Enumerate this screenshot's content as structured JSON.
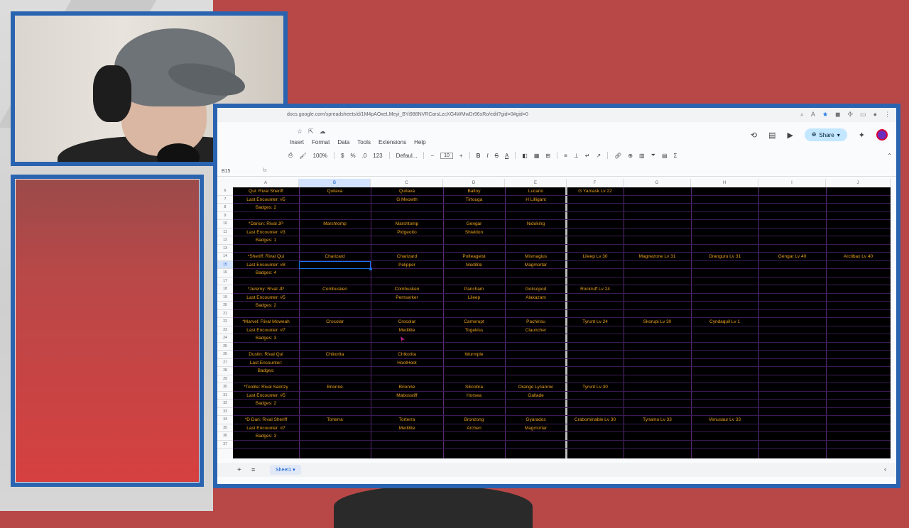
{
  "browser": {
    "url": "docs.google.com/spreadsheets/d/1M4pAOxeLMeyi_BYi988NVRCarsLzcXG4WMwDr96sRo/edit?gid=0#gid=0",
    "menu": [
      "Insert",
      "Format",
      "Data",
      "Tools",
      "Extensions",
      "Help"
    ],
    "share_label": "Share"
  },
  "toolbar": {
    "zoom": "100%",
    "currency": "$",
    "percent": "%",
    "decimals": ".0",
    "more_formats": "123",
    "font": "Defaul...",
    "font_size": "10",
    "bold": "B",
    "italic": "I",
    "strike": "S",
    "text_color": "A"
  },
  "formula_bar": {
    "name_box": "B15",
    "fx": "fx"
  },
  "columns": [
    "A",
    "B",
    "C",
    "D",
    "E",
    "F",
    "G",
    "H",
    "I",
    "J"
  ],
  "selected_column": "B",
  "rows": [
    {
      "num": "6",
      "cells": [
        "Qui: Rival Sheriff",
        "Quilava",
        "Quilava",
        "Baltoy",
        "Lucario",
        "G Yamask Lv 22",
        "",
        "",
        "",
        ""
      ]
    },
    {
      "num": "7",
      "cells": [
        "Last Encounter: #5",
        "",
        "G Meowth",
        "Tirtouga",
        "H Lilligant",
        "",
        "",
        "",
        "",
        ""
      ]
    },
    {
      "num": "8",
      "cells": [
        "Badges: 2",
        "",
        "",
        "",
        "",
        "",
        "",
        "",
        "",
        ""
      ]
    },
    {
      "num": "9",
      "cells": [
        "",
        "",
        "",
        "",
        "",
        "",
        "",
        "",
        "",
        ""
      ]
    },
    {
      "num": "10",
      "cells": [
        "*Darion: Rival JP",
        "Marshtomp",
        "Marshtomp",
        "Gengar",
        "Nidoking",
        "",
        "",
        "",
        "",
        ""
      ]
    },
    {
      "num": "11",
      "cells": [
        "Last Encounter: #3",
        "",
        "Pidgeotto",
        "Shieldon",
        "",
        "",
        "",
        "",
        "",
        ""
      ]
    },
    {
      "num": "12",
      "cells": [
        "Badges: 1",
        "",
        "",
        "",
        "",
        "",
        "",
        "",
        "",
        ""
      ]
    },
    {
      "num": "13",
      "cells": [
        "",
        "",
        "",
        "",
        "",
        "",
        "",
        "",
        "",
        ""
      ]
    },
    {
      "num": "14",
      "cells": [
        "*Sheriff: Rival Qui",
        "Charizard",
        "Charizard",
        "Polteageist",
        "Mismagius",
        "Lileep Lv 30",
        "Magnezone Lv 31",
        "Oranguru Lv 31",
        "Gengar Lv 40",
        "Arctibax Lv 40"
      ]
    },
    {
      "num": "15",
      "cells": [
        "Last Encounter: #8",
        "",
        "Pelipper",
        "Meditite",
        "Magmortar",
        "",
        "",
        "",
        "",
        ""
      ]
    },
    {
      "num": "16",
      "cells": [
        "Badges: 4",
        "",
        "",
        "",
        "",
        "",
        "",
        "",
        "",
        ""
      ]
    },
    {
      "num": "17",
      "cells": [
        "",
        "",
        "",
        "",
        "",
        "",
        "",
        "",
        "",
        ""
      ]
    },
    {
      "num": "18",
      "cells": [
        "*Jeremy: Rival JP",
        "Combusken",
        "Combusken",
        "Pancham",
        "Golisopod",
        "Rockruff Lv 24",
        "",
        "",
        "",
        ""
      ]
    },
    {
      "num": "19",
      "cells": [
        "Last Encounter: #5",
        "",
        "Pemserker",
        "Lileep",
        "Alakazam",
        "",
        "",
        "",
        "",
        ""
      ]
    },
    {
      "num": "20",
      "cells": [
        "Badges: 2",
        "",
        "",
        "",
        "",
        "",
        "",
        "",
        "",
        ""
      ]
    },
    {
      "num": "21",
      "cells": [
        "",
        "",
        "",
        "",
        "",
        "",
        "",
        "",
        "",
        ""
      ]
    },
    {
      "num": "22",
      "cells": [
        "*Marvel: Rival Moweah",
        "Crocolar",
        "Crocolar",
        "Camerupt",
        "Pachirisu",
        "Tyrunt Lv 24",
        "Skorupi Lv 30",
        "Cyndaquil Lv 1",
        "",
        ""
      ]
    },
    {
      "num": "23",
      "cells": [
        "Last Encounter: #7",
        "",
        "Meditite",
        "Togekiss",
        "Clauncher",
        "",
        "",
        "",
        "",
        ""
      ]
    },
    {
      "num": "24",
      "cells": [
        "Badges: 3",
        "",
        "",
        "",
        "",
        "",
        "",
        "",
        "",
        ""
      ]
    },
    {
      "num": "25",
      "cells": [
        "",
        "",
        "",
        "",
        "",
        "",
        "",
        "",
        "",
        ""
      ]
    },
    {
      "num": "26",
      "cells": [
        "Dustin: Rival Qui",
        "Chikorita",
        "Chikorita",
        "Wurmple",
        "",
        "",
        "",
        "",
        "",
        ""
      ]
    },
    {
      "num": "27",
      "cells": [
        "Last Encounter:",
        "",
        "HootHoot",
        "",
        "",
        "",
        "",
        "",
        "",
        ""
      ]
    },
    {
      "num": "28",
      "cells": [
        "Badges:",
        "",
        "",
        "",
        "",
        "",
        "",
        "",
        "",
        ""
      ]
    },
    {
      "num": "29",
      "cells": [
        "",
        "",
        "",
        "",
        "",
        "",
        "",
        "",
        "",
        ""
      ]
    },
    {
      "num": "30",
      "cells": [
        "*Toolite: Rival Saintzy",
        "Brionne",
        "Brionne",
        "Silicobra",
        "Orange Lycanroc",
        "Tyrunt Lv 30",
        "",
        "",
        "",
        ""
      ]
    },
    {
      "num": "31",
      "cells": [
        "Last Encounter: #5",
        "",
        "Mabosstiff",
        "Horsea",
        "Gallade",
        "",
        "",
        "",
        "",
        ""
      ]
    },
    {
      "num": "32",
      "cells": [
        "Badges: 2",
        "",
        "",
        "",
        "",
        "",
        "",
        "",
        "",
        ""
      ]
    },
    {
      "num": "33",
      "cells": [
        "",
        "",
        "",
        "",
        "",
        "",
        "",
        "",
        "",
        ""
      ]
    },
    {
      "num": "34",
      "cells": [
        "*D Dan: Rival Sheriff",
        "Torterra",
        "Torterra",
        "Bronzong",
        "Gyarados",
        "Crabominable Lv 30",
        "Tynamo Lv 33",
        "Venusaur Lv 33",
        "",
        ""
      ]
    },
    {
      "num": "35",
      "cells": [
        "Last Encounter: #7",
        "",
        "Meditite",
        "Archen",
        "Magmortar",
        "",
        "",
        "",
        "",
        ""
      ]
    },
    {
      "num": "36",
      "cells": [
        "Badges: 3",
        "",
        "",
        "",
        "",
        "",
        "",
        "",
        "",
        ""
      ]
    },
    {
      "num": "37",
      "cells": [
        "",
        "",
        "",
        "",
        "",
        "",
        "",
        "",
        "",
        ""
      ]
    }
  ],
  "sheet_tab": "Sheet1",
  "colors": {
    "cell_text": "#e8a020",
    "grid_bg": "#000000",
    "grid_lines": "#5a2a7a",
    "frame_blue": "#2a64b0",
    "overlay_red": "#b84848"
  }
}
